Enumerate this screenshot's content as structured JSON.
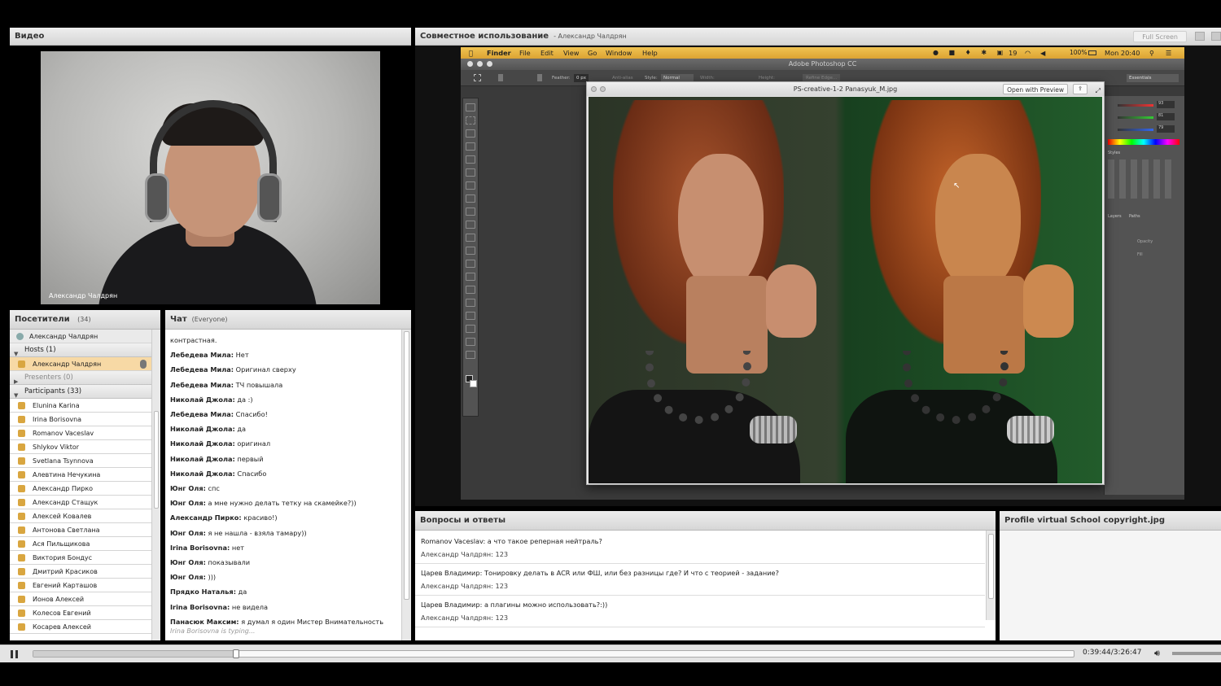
{
  "video": {
    "title": "Видео",
    "presenter_label": "Александр Чалдрян"
  },
  "share": {
    "title": "Совместное использование",
    "subtitle": "- Александр Чалдрян",
    "fullscreen_label": "Full Screen"
  },
  "mac": {
    "menu": [
      "Finder",
      "File",
      "Edit",
      "View",
      "Go",
      "Window",
      "Help"
    ],
    "status": {
      "battery": "100%",
      "clock": "Mon 20:40",
      "counter": "19"
    },
    "app_title": "Adobe Photoshop CC",
    "options": {
      "feather_label": "Feather:",
      "feather_value": "0 px",
      "antialias": "Anti-alias",
      "style_label": "Style:",
      "style_value": "Normal",
      "width_label": "Width:",
      "height_label": "Height:",
      "refine": "Refine Edge...",
      "workspace": "Essentials"
    },
    "preview": {
      "filename": "PS-creative-1-2 Panasyuk_M.jpg",
      "open_button": "Open with Preview"
    },
    "panels": {
      "color_values": [
        "93",
        "81",
        "79"
      ],
      "styles_tab": "Styles",
      "layers_tab": "Layers",
      "paths_tab": "Paths",
      "opacity": "Opacity",
      "fill": "Fill"
    }
  },
  "attendees": {
    "title": "Посетители",
    "count": "(34)",
    "me": "Александр Чалдрян",
    "hosts": {
      "label": "Hosts (1)",
      "items": [
        "Александр Чалдрян"
      ]
    },
    "presenters": {
      "label": "Presenters (0)"
    },
    "participants": {
      "label": "Participants (33)",
      "items": [
        "Elunina Karina",
        "Irina Borisovna",
        "Romanov Vaceslav",
        "Shlykov Viktor",
        "Svetlana Tsynnova",
        "Алевтина Нечукина",
        "Александр Пирко",
        "Александр Стащук",
        "Алексей Ковалев",
        "Антонова Светлана",
        "Ася Пильщикова",
        "Виктория Бондус",
        "Дмитрий Красиков",
        "Евгений Карташов",
        "Ионов Алексей",
        "Колесов Евгений",
        "Косарев Алексей"
      ]
    }
  },
  "chat": {
    "title": "Чат",
    "scope": "(Everyone)",
    "messages": [
      {
        "author": "",
        "text": "контрастная."
      },
      {
        "author": "Лебедева Мила:",
        "text": "Нет"
      },
      {
        "author": "Лебедева Мила:",
        "text": "Оригинал сверху"
      },
      {
        "author": "Лебедева Мила:",
        "text": "ТЧ повышала"
      },
      {
        "author": "Николай Джола:",
        "text": "да :)"
      },
      {
        "author": "Лебедева Мила:",
        "text": "Спасибо!"
      },
      {
        "author": "Николай Джола:",
        "text": "да"
      },
      {
        "author": "Николай Джола:",
        "text": "оригинал"
      },
      {
        "author": "Николай Джола:",
        "text": "первый"
      },
      {
        "author": "Николай Джола:",
        "text": "Спасибо"
      },
      {
        "author": "Юнг Оля:",
        "text": "спс"
      },
      {
        "author": "Юнг Оля:",
        "text": "а мне нужно делать тетку на скамейке?))"
      },
      {
        "author": "Александр Пирко:",
        "text": "красиво!)"
      },
      {
        "author": "Юнг Оля:",
        "text": "я не нашла - взяла тамару))"
      },
      {
        "author": "Irina Borisovna:",
        "text": "нет"
      },
      {
        "author": "Юнг Оля:",
        "text": "показывали"
      },
      {
        "author": "Юнг Оля:",
        "text": ")))"
      },
      {
        "author": "Прядко Наталья:",
        "text": "да"
      },
      {
        "author": "Irina Borisovna:",
        "text": "не видела"
      },
      {
        "author": "Панасюк Максим:",
        "text": "я думал я один Мистер Внимательность"
      }
    ],
    "typing": "Irina Borisovna is typing..."
  },
  "qa": {
    "title": "Вопросы и ответы",
    "items": [
      {
        "question": "Romanov Vaceslav: а что такое реперная нейтраль?",
        "answer": "Александр Чалдрян: 123"
      },
      {
        "question": "Царев Владимир: Тонировку делать в ACR или ФШ, или без разницы где? И что с теорией - задание?",
        "answer": "Александр Чалдрян: 123"
      },
      {
        "question": "Царев Владимир: а плагины можно использовать?:))",
        "answer": "Александр Чалдрян: 123"
      }
    ]
  },
  "profile": {
    "title": "Profile virtual School copyright.jpg"
  },
  "player": {
    "time": "0:39:44/3:26:47",
    "progress": 0.195
  },
  "colors": {
    "accent_highlight": "#f7d9a5",
    "mac_menubar": "#e7b43c",
    "ps_background": "#3a3a3a",
    "photo_bg_left": "#2f3a2c",
    "photo_bg_right": "#1f5a2c"
  }
}
